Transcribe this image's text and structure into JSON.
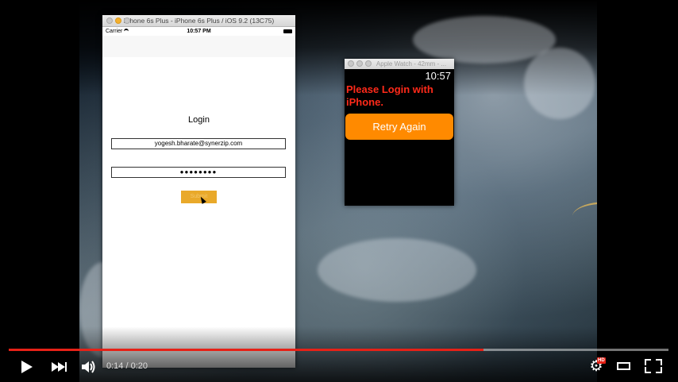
{
  "simulator": {
    "title": "iPhone 6s Plus - iPhone 6s Plus / iOS 9.2 (13C75)",
    "carrier": "Carrier",
    "time": "10:57 PM",
    "login_title": "Login",
    "email_value": "yogesh.bharate@synerzip.com",
    "password_value": "●●●●●●●●",
    "submit_label": "Submit",
    "submit_color": "#e9a92a"
  },
  "watch": {
    "title": "Apple Watch - 42mm - ...",
    "time": "10:57",
    "message": "Please Login with iPhone.",
    "retry_label": "Retry Again",
    "message_color": "#ff2a1a",
    "button_color": "#ff8a00"
  },
  "player": {
    "current_time": "0:14",
    "separator": " / ",
    "duration": "0:20",
    "progress_fraction": 0.72,
    "progress_color": "#e62117",
    "hd_badge": "HD",
    "icons": [
      "play-icon",
      "next-icon",
      "volume-icon",
      "settings-icon",
      "theater-icon",
      "fullscreen-icon"
    ]
  }
}
